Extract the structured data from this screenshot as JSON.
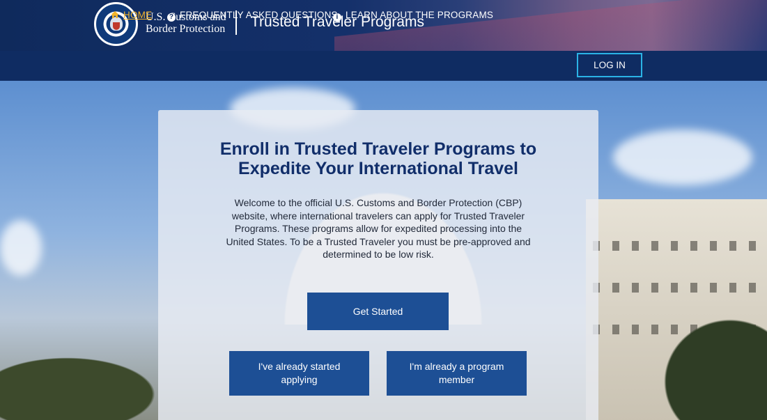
{
  "header": {
    "agency_line1": "U.S. Customs and",
    "agency_line2": "Border Protection",
    "site_title": "Trusted Traveler Programs"
  },
  "nav": {
    "items": [
      {
        "label": "HOME",
        "icon": "home-icon",
        "active": true
      },
      {
        "label": "FREQUENTLY ASKED QUESTIONS",
        "icon": "question-circle-icon"
      },
      {
        "label": "LEARN ABOUT THE PROGRAMS",
        "icon": "info-circle-icon"
      }
    ],
    "login_label": "LOG IN"
  },
  "main": {
    "headline_line1": "Enroll in Trusted Traveler Programs to",
    "headline_line2": "Expedite Your International Travel",
    "intro": "Welcome to the official U.S. Customs and Border Protection (CBP) website, where international travelers can apply for Trusted Traveler Programs. These programs allow for expedited processing into the United States. To be a Trusted Traveler you must be pre-approved and determined to be low risk.",
    "get_started_label": "Get Started",
    "already_started_label": "I've already started applying",
    "program_member_label": "I'm already a program member"
  },
  "colors": {
    "header_bg": "#0f2c62",
    "nav_active": "#f3b42a",
    "login_border": "#2bb3e6",
    "button_bg": "#1d4f95",
    "headline": "#112e6a"
  }
}
